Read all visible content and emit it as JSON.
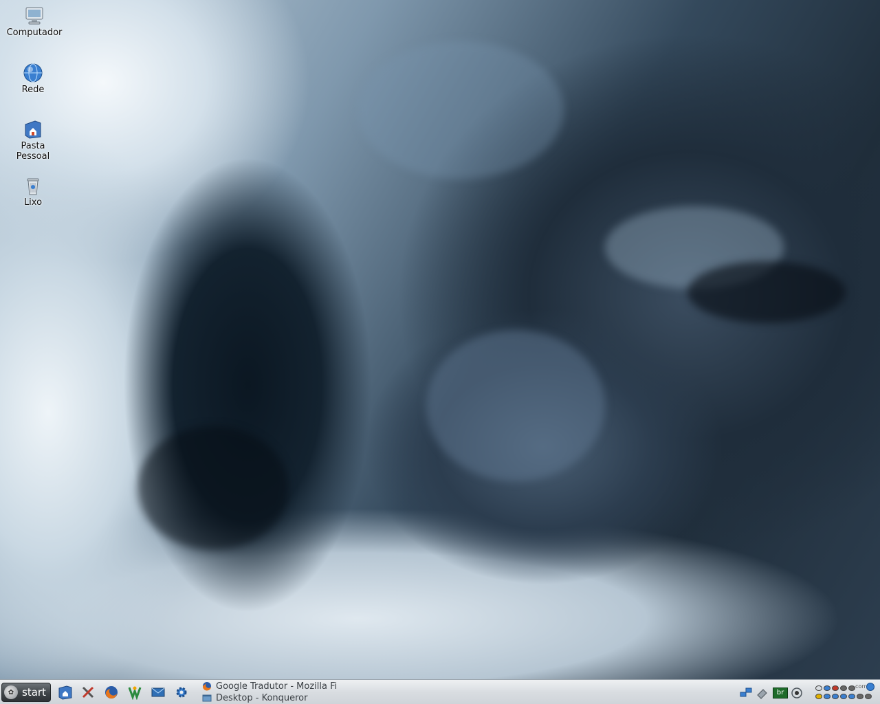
{
  "desktop": {
    "icons": [
      {
        "label": "Computador",
        "icon": "computer-icon"
      },
      {
        "label": "Rede",
        "icon": "network-globe-icon"
      },
      {
        "label": "Pasta\nPessoal",
        "icon": "home-folder-icon"
      },
      {
        "label": "Lixo",
        "icon": "trash-icon"
      }
    ]
  },
  "taskbar": {
    "start_label": "start",
    "quicklaunch": [
      {
        "icon": "home-folder-icon"
      },
      {
        "icon": "system-tools-icon"
      },
      {
        "icon": "firefox-icon"
      },
      {
        "icon": "messenger-icon"
      },
      {
        "icon": "mail-icon"
      },
      {
        "icon": "settings-gear-icon"
      }
    ],
    "tasks": [
      {
        "label": "Google Tradutor - Mozilla Firefox",
        "icon": "firefox-icon"
      },
      {
        "label": "Desktop - Konqueror",
        "icon": "konqueror-icon"
      }
    ],
    "tray": [
      {
        "icon": "network-status-icon"
      },
      {
        "icon": "clipboard-icon"
      },
      {
        "label": "br",
        "icon": "keyboard-layout-icon"
      },
      {
        "icon": "camera-eye-icon"
      }
    ],
    "pager_label": "corr"
  },
  "colors": {
    "taskbar_bg": "#d9dde1",
    "start_bg": "#3f4448",
    "task_text": "#3a3f44"
  }
}
